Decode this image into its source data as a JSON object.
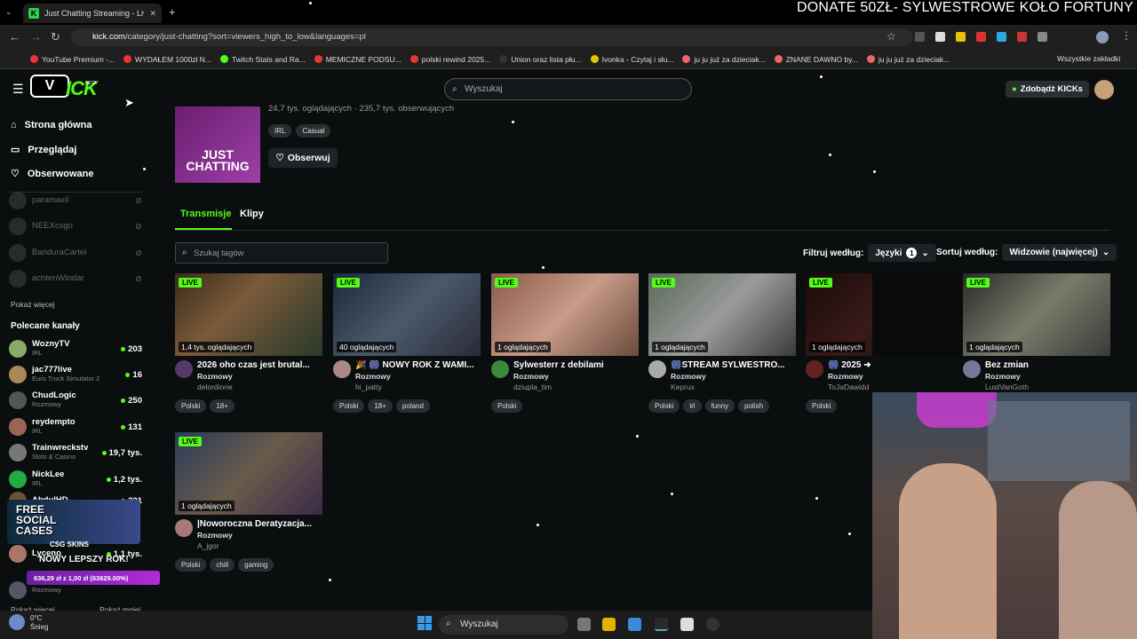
{
  "browser": {
    "tab_title": "Just Chatting Streaming - Live S",
    "url_host": "kick.com",
    "url_path": "/category/just-chatting?sort=viewers_high_to_low&languages=pl",
    "bookmarks": [
      "YouTube Premium -...",
      "WYDAŁEM 1000zł N...",
      "Twitch Stats and Ra...",
      "MEMICZNE PODSU...",
      "polski rewind 2025...",
      "Union oraz lista płu...",
      "Ivonka - Czytaj i słu...",
      "ju ju już za dzieciak...",
      "ZNANE DAWNO by...",
      "ju ju już za dzieciak..."
    ],
    "all_bookmarks": "Wszystkie zakładki"
  },
  "overlay": {
    "donate": "DONATE 50ZŁ- SYLWESTROWE KOŁO FORTUNY",
    "promo_title": "FREE SOCIAL CASES",
    "promo_sub": "CSG SKINS",
    "promo_banner": "NOWY LEPSZY ROK!",
    "promo_amount": "636,29 zł z 1,00 zł (63629.00%)"
  },
  "header": {
    "logo_badge": "V",
    "logo_text": "ICK",
    "logo_beta": "BETA",
    "search_placeholder": "Wyszukaj",
    "kicks_label": "Zdobądź KICKs"
  },
  "sidebar": {
    "nav": [
      "Strona główna",
      "Przeglądaj",
      "Obserwowane"
    ],
    "offline": [
      "paramaxil",
      "NEEXcsgo",
      "BanduraCartel",
      "achtenWlodar"
    ],
    "show_more": "Pokaż więcej",
    "recommended_title": "Polecane kanały",
    "recommended": [
      {
        "name": "WoznyTV",
        "cat": "IRL",
        "count": "203"
      },
      {
        "name": "jac777live",
        "cat": "Euro Truck Simulator 2",
        "count": "16"
      },
      {
        "name": "ChudLogic",
        "cat": "Rozmowy",
        "count": "250"
      },
      {
        "name": "reydempto",
        "cat": "IRL",
        "count": "131"
      },
      {
        "name": "Trainwreckstv",
        "cat": "Slots & Casino",
        "count": "19,7 tys."
      },
      {
        "name": "NickLee",
        "cat": "IRL",
        "count": "1,2 tys."
      },
      {
        "name": "AbdulHD",
        "cat": "",
        "count": "321"
      },
      {
        "name": "Lyceno",
        "cat": "",
        "count": "1,1 tys."
      },
      {
        "name": "",
        "cat": "Rozmowy",
        "count": ""
      }
    ],
    "show_more2": "Pokaż więcej",
    "show_less": "Pokaż mniej"
  },
  "category": {
    "stats": "24,7 tys. oglądających · 235,7 tys. obserwujących",
    "cover_text": "JUST CHATTING",
    "tags": [
      "IRL",
      "Casual"
    ],
    "follow": "Obserwuj",
    "tab_streams": "Transmisje",
    "tab_clips": "Klipy",
    "tag_search": "Szukaj tagów",
    "filter_label": "Filtruj według:",
    "filter_value": "Języki",
    "filter_count": "1",
    "sort_label": "Sortuj według:",
    "sort_value": "Widzowie (najwięcej)"
  },
  "streams": [
    {
      "live": "LIVE",
      "viewers": "1,4 tys. oglądających",
      "title": "2026 oho czas jest brutal...",
      "cat": "Rozmowy",
      "user": "delordione",
      "tags": [
        "Polski",
        "18+"
      ]
    },
    {
      "live": "LIVE",
      "viewers": "40 oglądających",
      "title": "🎉 🎆 NOWY ROK Z WAMI...",
      "cat": "Rozmowy",
      "user": "hi_patty",
      "tags": [
        "Polski",
        "18+",
        "poland"
      ]
    },
    {
      "live": "LIVE",
      "viewers": "1 oglądających",
      "title": "Sylwesterr z debilami",
      "cat": "Rozmowy",
      "user": "dziupla_tim",
      "tags": [
        "Polski"
      ]
    },
    {
      "live": "LIVE",
      "viewers": "1 oglądających",
      "title": "🎆STREAM SYLWESTRO...",
      "cat": "Rozmowy",
      "user": "Keprux",
      "tags": [
        "Polski",
        "irl",
        "funny",
        "polish"
      ]
    },
    {
      "live": "LIVE",
      "viewers": "1 oglądających",
      "title": "🎆 2025 ➜ 2026 | SYLWE...",
      "cat": "Rozmowy",
      "user": "ToJaDawidd",
      "tags": [
        "Polski"
      ]
    },
    {
      "live": "LIVE",
      "viewers": "1 oglądających",
      "title": "Bez zmian",
      "cat": "Rozmowy",
      "user": "LustVanGoth",
      "tags": []
    },
    {
      "live": "LIVE",
      "viewers": "1 oglądających",
      "title": "|Noworoczna Deratyzacja...",
      "cat": "Rozmowy",
      "user": "A_jgor",
      "tags": [
        "Polski",
        "chill",
        "gaming"
      ]
    }
  ],
  "taskbar": {
    "weather_temp": "0°C",
    "weather_desc": "Śnieg",
    "search": "Wyszukaj"
  },
  "colors": {
    "accent": "#53fc18",
    "bg": "#0b0e0f"
  }
}
